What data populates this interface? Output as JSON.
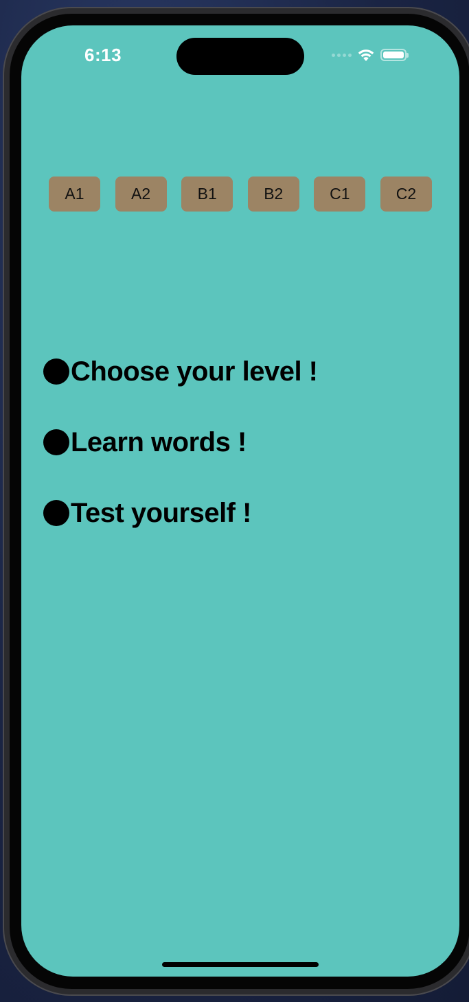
{
  "status_bar": {
    "time": "6:13",
    "icons": [
      "cellular-signal-icon",
      "wifi-icon",
      "battery-icon"
    ]
  },
  "levels": [
    "A1",
    "A2",
    "B1",
    "B2",
    "C1",
    "C2"
  ],
  "bullets": [
    "Choose your level !",
    "Learn words !",
    "Test yourself !"
  ],
  "colors": {
    "screen_background": "#5cc5bd",
    "level_button": "#9c8464",
    "text": "#000000"
  }
}
